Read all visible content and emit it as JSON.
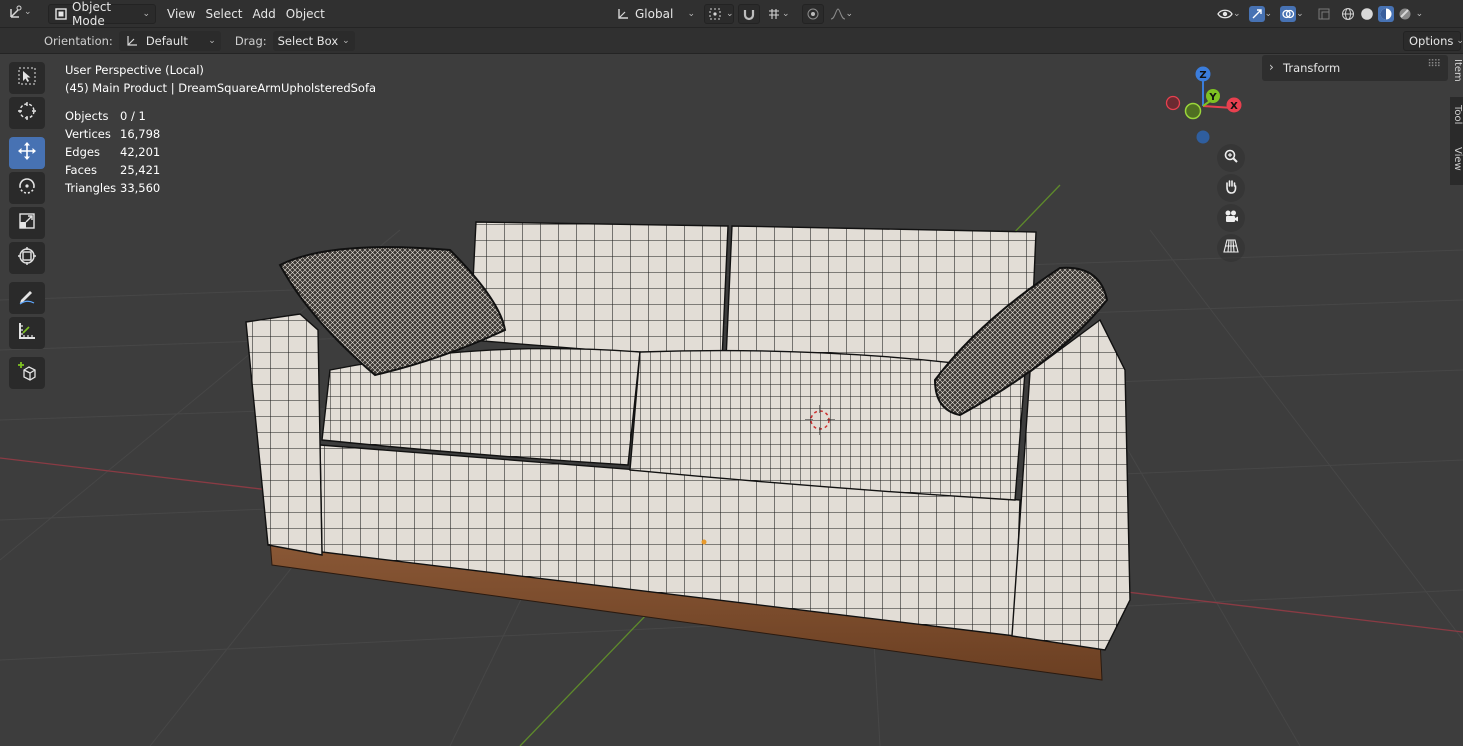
{
  "header": {
    "mode": "Object Mode",
    "menus": [
      "View",
      "Select",
      "Add",
      "Object"
    ],
    "transform_orientation": "Global",
    "options_label": "Options"
  },
  "toolsettings": {
    "orientation_label": "Orientation:",
    "orientation_value": "Default",
    "drag_label": "Drag:",
    "drag_value": "Select Box"
  },
  "viewport": {
    "view_name": "User Perspective (Local)",
    "collection": "(45) Main Product | DreamSquareArmUpholsteredSofa",
    "stats": [
      {
        "label": "Objects",
        "value": "0 / 1"
      },
      {
        "label": "Vertices",
        "value": "16,798"
      },
      {
        "label": "Edges",
        "value": "42,201"
      },
      {
        "label": "Faces",
        "value": "25,421"
      },
      {
        "label": "Triangles",
        "value": "33,560"
      }
    ],
    "gizmo": {
      "z": "Z",
      "y": "Y",
      "x": "X"
    }
  },
  "sidebar": {
    "panel_title": "Transform",
    "tabs": [
      "Item",
      "Tool",
      "View"
    ]
  },
  "tools": [
    "select-box",
    "cursor",
    "move",
    "rotate",
    "scale",
    "transform",
    "annotate",
    "measure",
    "add-cube"
  ],
  "colors": {
    "active_tool": "#4772b3",
    "axis_x": "#e8404f",
    "axis_y": "#7ec222",
    "axis_z": "#3b7ddc",
    "wood": "#7a4a2c",
    "fabric": "#ddd7d0"
  }
}
